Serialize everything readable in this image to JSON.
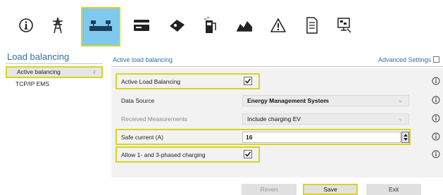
{
  "toolbar": {
    "buttons": [
      {
        "icon": "info-circle-icon"
      },
      {
        "icon": "power-pylon-icon"
      },
      {
        "icon": "load-balancing-icon",
        "active": true
      },
      {
        "icon": "payment-card-icon"
      },
      {
        "icon": "rfid-tag-icon"
      },
      {
        "icon": "charging-station-icon"
      },
      {
        "icon": "energy-meter-icon"
      },
      {
        "icon": "warning-icon"
      },
      {
        "icon": "log-document-icon"
      },
      {
        "icon": "network-monitor-icon"
      }
    ]
  },
  "sidebar": {
    "title": "Load balancing",
    "items": [
      {
        "label": "Active balancing",
        "active": true
      },
      {
        "label": "TCP/IP EMS",
        "active": false
      }
    ]
  },
  "main": {
    "section_title": "Active load balancing",
    "advanced_settings_label": "Advanced Settings",
    "advanced_settings_checked": false,
    "rows": {
      "active_load_balancing": {
        "label": "Active Load Balancing",
        "checked": true
      },
      "data_source": {
        "label": "Data Source",
        "value": "Energy Management System"
      },
      "received_measurements": {
        "label": "Received Measurements",
        "value": "Include charging EV"
      },
      "safe_current": {
        "label": "Safe current (A)",
        "value": "16"
      },
      "phased_charging": {
        "label": "Allow 1- and 3-phased charging",
        "checked": true
      }
    }
  },
  "footer": {
    "revert_label": "Revert",
    "save_label": "Save",
    "exit_label": "Exit"
  },
  "colors": {
    "accent_blue": "#2f6fae",
    "highlight_yellow": "#d6d51f",
    "active_tab_bg": "#7fc8ee",
    "panel_bg": "#f2f2f2"
  }
}
